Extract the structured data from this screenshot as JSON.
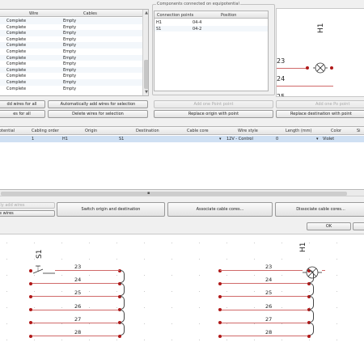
{
  "wires_table": {
    "headers": [
      "Wire",
      "Cables"
    ],
    "rows": [
      {
        "wire": "Complete",
        "cables": "Empty"
      },
      {
        "wire": "Complete",
        "cables": "Empty"
      },
      {
        "wire": "Complete",
        "cables": "Empty"
      },
      {
        "wire": "Complete",
        "cables": "Empty"
      },
      {
        "wire": "Complete",
        "cables": "Empty"
      },
      {
        "wire": "Complete",
        "cables": "Empty"
      },
      {
        "wire": "Complete",
        "cables": "Empty"
      },
      {
        "wire": "Complete",
        "cables": "Empty"
      },
      {
        "wire": "Complete",
        "cables": "Empty"
      },
      {
        "wire": "Complete",
        "cables": "Empty"
      },
      {
        "wire": "Complete",
        "cables": "Empty"
      },
      {
        "wire": "Complete",
        "cables": "Empty"
      }
    ]
  },
  "wire_buttons": {
    "add_all": "dd wires for all",
    "auto_add": "Automatically add wires for selection",
    "delete_all": "es for all",
    "delete_sel": "Delete wires for selection"
  },
  "components": {
    "group_title": "Components connected on equipotential",
    "headers": [
      "Connection points",
      "Position"
    ],
    "rows": [
      {
        "point": "H1",
        "position": "04-4"
      },
      {
        "point": "S1",
        "position": "04-2"
      }
    ]
  },
  "point_buttons": {
    "add_origin_point": "Add one Point point",
    "replace_origin": "Replace origin with point",
    "add_dest_point": "Add one Po point",
    "replace_dest": "Replace destination with point"
  },
  "preview": {
    "label": "H1",
    "terminals": [
      "23",
      "24",
      "25"
    ]
  },
  "cable_table": {
    "headers": [
      "otential",
      "Cabling order",
      "Origin",
      "Destination",
      "Cable core",
      "Wire style",
      "Length (mm)",
      "Color",
      "Si"
    ],
    "row": {
      "cabling_order": "1",
      "origin": "H1",
      "destination": "S1",
      "cable_core": "",
      "wire_style": "12V - Control",
      "length": "0",
      "color": "Violet"
    }
  },
  "bottom_buttons": {
    "auto_add_small": "lly add wires",
    "wires_small": "e wires",
    "switch": "Switch origin and destination",
    "associate": "Associate cable cores...",
    "dissociate": "Dissociate cable cores...",
    "ok": "OK"
  },
  "schematic": {
    "left_label": "S1",
    "right_label": "H1",
    "left_terminals": [
      "23",
      "24",
      "25",
      "26",
      "27",
      "28"
    ],
    "right_terminals": [
      "23",
      "24",
      "25",
      "26",
      "27",
      "28"
    ]
  },
  "colors": {
    "wire_red": "#d06a6a",
    "terminal_dot": "#b01818",
    "selection_blue": "#cfe0f3"
  }
}
